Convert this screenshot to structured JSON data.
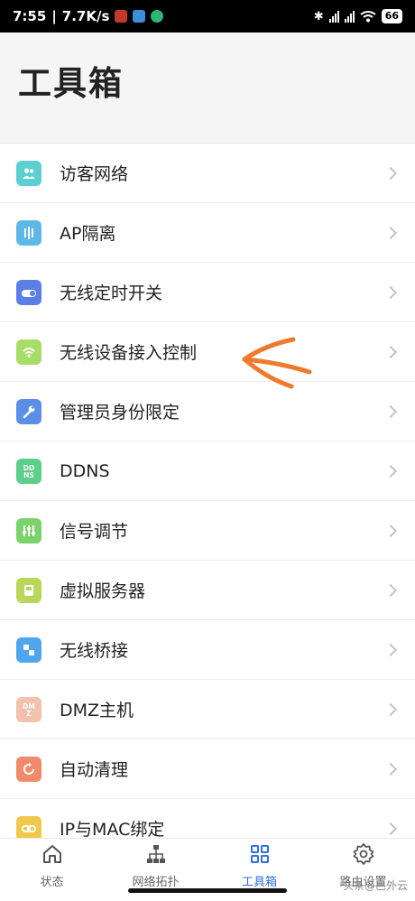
{
  "status_bar": {
    "time": "7:55",
    "speed": "7.7K/s",
    "battery": "66"
  },
  "page_title": "工具箱",
  "tools": [
    {
      "label": "访客网络",
      "icon": "guest-users-icon",
      "color": "#5ccfd0"
    },
    {
      "label": "AP隔离",
      "icon": "ap-isolation-icon",
      "color": "#5db8e8"
    },
    {
      "label": "无线定时开关",
      "icon": "wifi-timer-toggle-icon",
      "color": "#5b7fe6"
    },
    {
      "label": "无线设备接入控制",
      "icon": "wifi-access-control-icon",
      "color": "#a9dd6a"
    },
    {
      "label": "管理员身份限定",
      "icon": "admin-wrench-icon",
      "color": "#5b8fe6"
    },
    {
      "label": "DDNS",
      "icon": "ddns-icon",
      "color": "#5ccf8a",
      "icon_text": "DDNS"
    },
    {
      "label": "信号调节",
      "icon": "signal-adjust-icon",
      "color": "#7ad36a"
    },
    {
      "label": "虚拟服务器",
      "icon": "virtual-server-icon",
      "color": "#b9d85a"
    },
    {
      "label": "无线桥接",
      "icon": "wireless-bridge-icon",
      "color": "#4fa6ee"
    },
    {
      "label": "DMZ主机",
      "icon": "dmz-host-icon",
      "color": "#f3c1ac",
      "icon_text": "DMZ"
    },
    {
      "label": "自动清理",
      "icon": "auto-clean-icon",
      "color": "#f08a6a"
    },
    {
      "label": "IP与MAC绑定",
      "icon": "ip-mac-bind-icon",
      "color": "#f2c84a"
    }
  ],
  "tabs": [
    {
      "label": "状态",
      "icon": "home-icon",
      "active": false
    },
    {
      "label": "网络拓扑",
      "icon": "topology-icon",
      "active": false
    },
    {
      "label": "工具箱",
      "icon": "toolbox-grid-icon",
      "active": true
    },
    {
      "label": "路由设置",
      "icon": "gear-icon",
      "active": false
    }
  ],
  "colors": {
    "accent": "#2f6fe4",
    "annotation_arrow": "#f07a2c"
  },
  "watermark": "头条@巴外云"
}
